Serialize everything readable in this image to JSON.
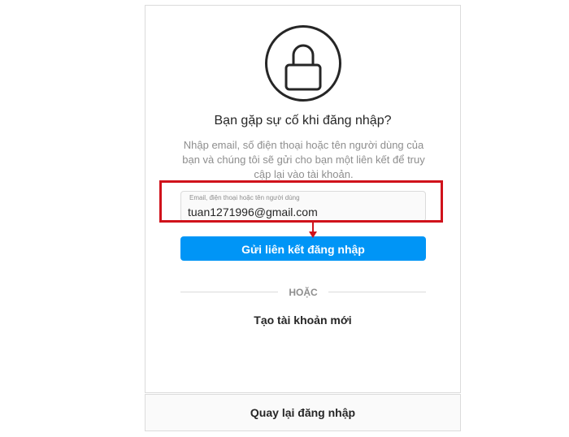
{
  "recover": {
    "title": "Bạn gặp sự cố khi đăng nhập?",
    "description": "Nhập email, số điện thoại hoặc tên người dùng của bạn và chúng tôi sẽ gửi cho bạn một liên kết để truy cập lại vào tài khoản.",
    "input_label": "Email, điện thoại hoặc tên người dùng",
    "input_value": "tuan1271996@gmail.com",
    "submit_label": "Gửi liên kết đăng nhập",
    "divider_text": "HOẶC",
    "create_account_label": "Tạo tài khoản mới"
  },
  "footer": {
    "back_label": "Quay lại đăng nhập"
  },
  "icons": {
    "lock": "lock-icon"
  },
  "colors": {
    "primary": "#0095f6",
    "annotation": "#d0121b",
    "border": "#dbdbdb",
    "muted_text": "#8e8e8e"
  }
}
